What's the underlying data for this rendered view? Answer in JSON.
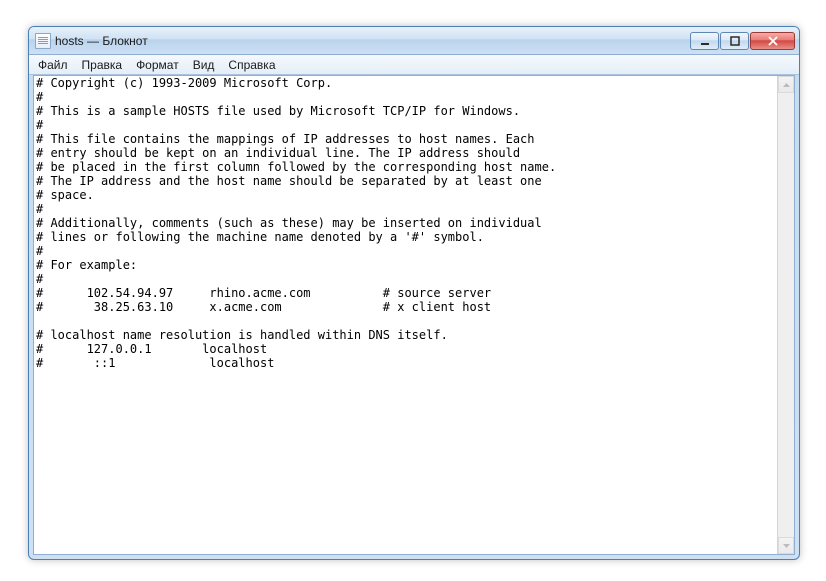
{
  "window": {
    "title": "hosts — Блокнот"
  },
  "menu": {
    "file": "Файл",
    "edit": "Правка",
    "format": "Формат",
    "view": "Вид",
    "help": "Справка"
  },
  "content": "# Copyright (c) 1993-2009 Microsoft Corp.\n#\n# This is a sample HOSTS file used by Microsoft TCP/IP for Windows.\n#\n# This file contains the mappings of IP addresses to host names. Each\n# entry should be kept on an individual line. The IP address should\n# be placed in the first column followed by the corresponding host name.\n# The IP address and the host name should be separated by at least one\n# space.\n#\n# Additionally, comments (such as these) may be inserted on individual\n# lines or following the machine name denoted by a '#' symbol.\n#\n# For example:\n#\n#      102.54.94.97     rhino.acme.com          # source server\n#       38.25.63.10     x.acme.com              # x client host\n\n# localhost name resolution is handled within DNS itself.\n#      127.0.0.1       localhost\n#       ::1             localhost"
}
